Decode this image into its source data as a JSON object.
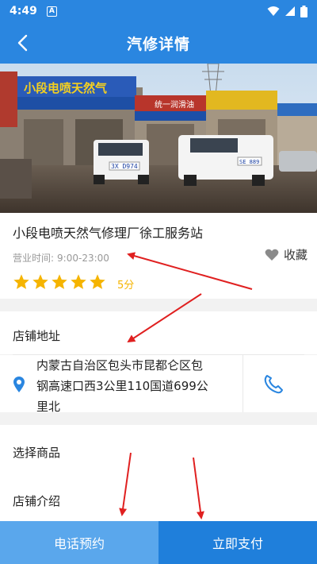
{
  "status_bar": {
    "time": "4:49",
    "badge": "A"
  },
  "header": {
    "title": "汽修详情"
  },
  "hero": {
    "signs": [
      "小段电喷天然气",
      "统一润滑油"
    ],
    "plates": [
      "3X D974",
      "SE 889"
    ]
  },
  "shop": {
    "name": "小段电喷天然气修理厂徐工服务站",
    "hours_label": "营业时间:",
    "hours_value": "9:00-23:00",
    "favorite_label": "收藏",
    "rating": 5,
    "score_text": "5分"
  },
  "address": {
    "section_label": "店铺地址",
    "line1": "内蒙古自治区包头市昆都仑区包",
    "line2": "钢高速口西3公里110国道699公",
    "line3": "里北"
  },
  "goods": {
    "label": "选择商品"
  },
  "intro": {
    "label": "店铺介绍"
  },
  "actions": {
    "call_label": "电话预约",
    "pay_label": "立即支付"
  },
  "colors": {
    "primary": "#2a86e0",
    "star": "#f5b400",
    "annotation_arrow": "#e02020"
  }
}
